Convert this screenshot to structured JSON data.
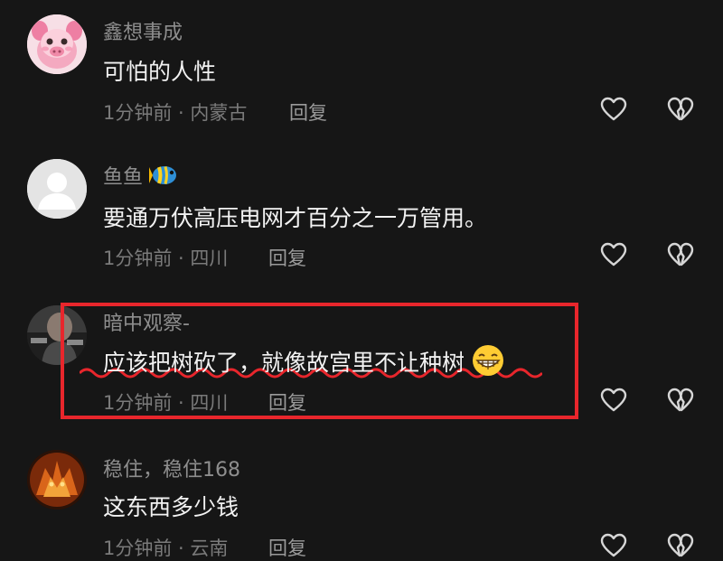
{
  "comments": [
    {
      "username": "鑫想事成",
      "text": "可怕的人性",
      "meta": "1分钟前 · 内蒙古",
      "reply_label": "回复",
      "avatar": "pink-pig-cartoon-avatar"
    },
    {
      "username": "鱼鱼",
      "username_emoji": "tropical-fish-icon",
      "text": "要通万伏高压电网才百分之一万管用。",
      "meta": "1分钟前 · 四川",
      "reply_label": "回复",
      "avatar": "default-grey-avatar",
      "underline_color": "#e8262c"
    },
    {
      "username": "暗中观察-",
      "text": "应该把树砍了，就像故宫里不让种树",
      "text_emoji": "grinning-face-icon",
      "meta": "1分钟前 · 四川",
      "reply_label": "回复",
      "avatar": "dark-portrait-avatar",
      "highlight_color": "#e8262c"
    },
    {
      "username": "稳住，稳住168",
      "text": "这东西多少钱",
      "meta": "1分钟前 · 云南",
      "reply_label": "回复",
      "avatar": "fiery-character-avatar"
    }
  ],
  "icons": {
    "like": "heart-outline-icon",
    "dislike": "broken-heart-icon"
  },
  "colors": {
    "background": "#161616",
    "text": "#f2f2f2",
    "username": "#8e8e8e",
    "meta": "#7a7a7a",
    "annotation_red": "#e8262c"
  }
}
